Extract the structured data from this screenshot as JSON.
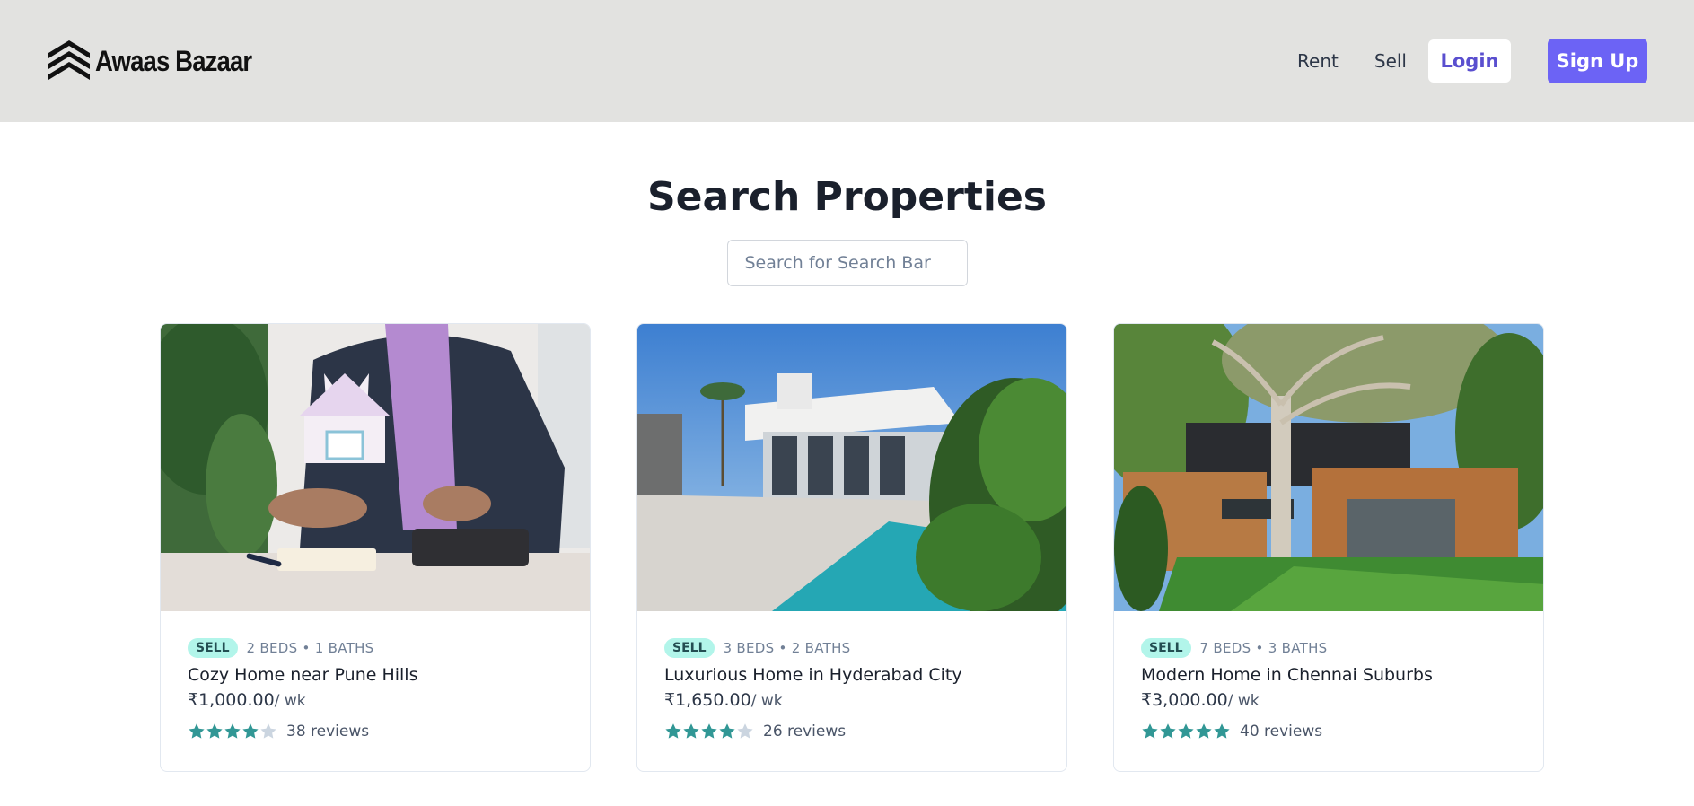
{
  "brand": {
    "name": "Awaas Bazaar",
    "icon": "chevron-stack-logo"
  },
  "nav": {
    "rent_label": "Rent",
    "sell_label": "Sell",
    "login_label": "Login",
    "signup_label": "Sign Up"
  },
  "colors": {
    "accent": "#6c63f5",
    "star_filled": "#319795",
    "star_empty": "#cbd5e0",
    "badge_bg": "#b2f5ea"
  },
  "page": {
    "title": "Search Properties",
    "search_placeholder": "Search for Search Bar"
  },
  "listings": [
    {
      "badge": "SELL",
      "specs": "2 BEDS • 1 BATHS",
      "title": "Cozy Home near Pune Hills",
      "price": "₹1,000.00",
      "unit": "/ wk",
      "rating": 4,
      "reviews": "38 reviews"
    },
    {
      "badge": "SELL",
      "specs": "3 BEDS • 2 BATHS",
      "title": "Luxurious Home in Hyderabad City",
      "price": "₹1,650.00",
      "unit": "/ wk",
      "rating": 4,
      "reviews": "26 reviews"
    },
    {
      "badge": "SELL",
      "specs": "7 BEDS • 3 BATHS",
      "title": "Modern Home in Chennai Suburbs",
      "price": "₹3,000.00",
      "unit": "/ wk",
      "rating": 5,
      "reviews": "40 reviews"
    }
  ]
}
